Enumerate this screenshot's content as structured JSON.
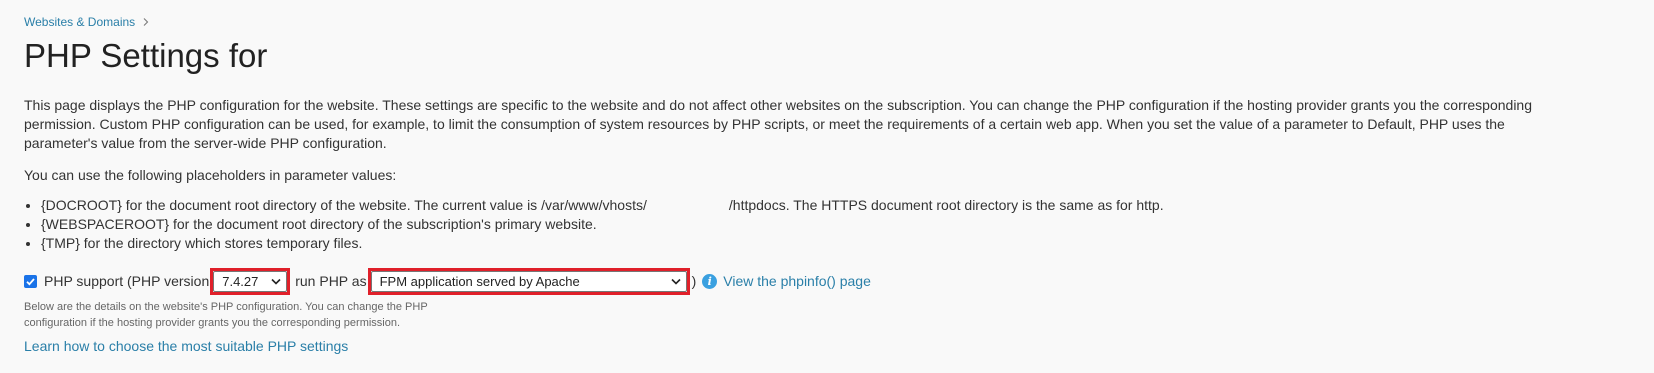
{
  "breadcrumb": {
    "items": [
      "Websites & Domains"
    ]
  },
  "page": {
    "title": "PHP Settings for",
    "description": "This page displays the PHP configuration for the website. These settings are specific to the website and do not affect other websites on the subscription. You can change the PHP configuration if the hosting provider grants you the corresponding permission. Custom PHP configuration can be used, for example, to limit the consumption of system resources by PHP scripts, or meet the requirements of a certain web app. When you set the value of a parameter to Default, PHP uses the parameter's value from the server-wide PHP configuration."
  },
  "placeholders": {
    "intro": "You can use the following placeholders in parameter values:",
    "items": [
      {
        "text_before": "{DOCROOT} for the document root directory of the website. The current value is /var/www/vhosts/",
        "text_after": "/httpdocs. The HTTPS document root directory is the same as for http."
      },
      {
        "text": "{WEBSPACEROOT} for the document root directory of the subscription's primary website."
      },
      {
        "text": "{TMP} for the directory which stores temporary files."
      }
    ]
  },
  "php_support": {
    "checked": true,
    "label_prefix": "PHP support (PHP version",
    "version_selected": "7.4.27",
    "run_as_label": "run PHP as",
    "handler_selected": "FPM application served by Apache",
    "closing_paren": ")",
    "info_icon": "i",
    "phpinfo_link": "View the phpinfo() page"
  },
  "hint": "Below are the details on the website's PHP configuration. You can change the PHP configuration if the hosting provider grants you the corresponding permission.",
  "learn_link": "Learn how to choose the most suitable PHP settings",
  "colors": {
    "link": "#2a7fa8",
    "highlight": "#e0202a",
    "checkbox": "#1a73e8",
    "info": "#3aa0e0"
  }
}
